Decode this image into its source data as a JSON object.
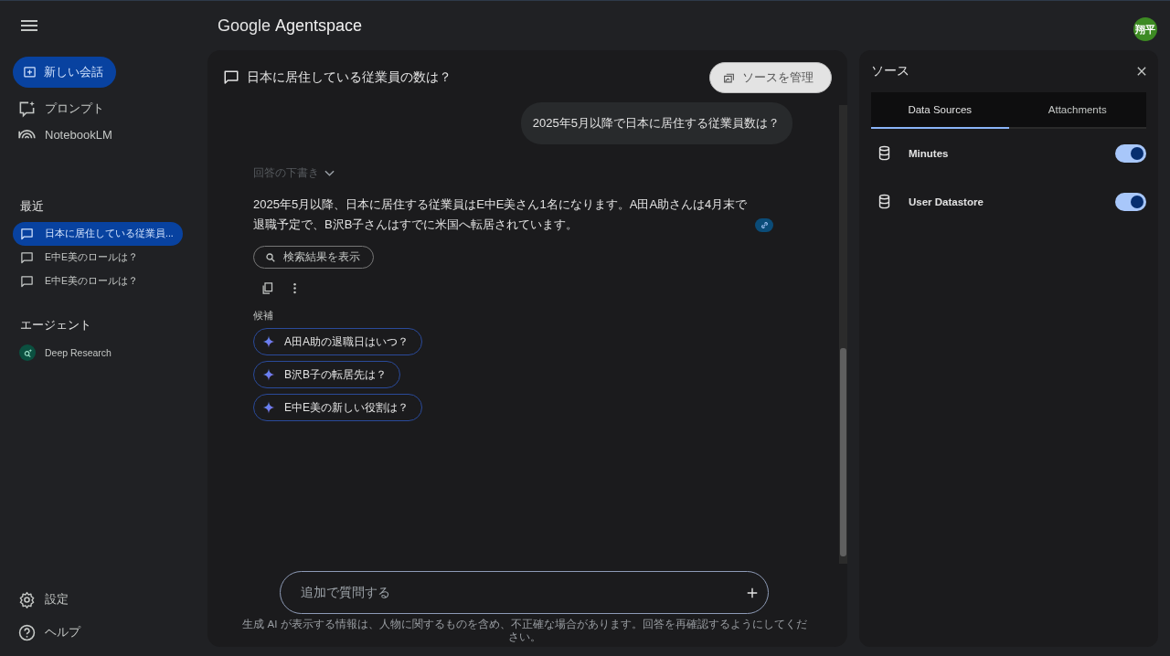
{
  "header": {
    "logo": "Google **Agentspace**",
    "avatar": "翔平"
  },
  "sidebar": {
    "new_chat": "新しい会話",
    "nav": [
      {
        "kind": "prompt",
        "label": "プロンプト"
      },
      {
        "kind": "notebook",
        "label": "NotebookLM"
      }
    ],
    "recent_heading": "最近",
    "recent": [
      {
        "label": "日本に居住している従業員...",
        "selected": true
      },
      {
        "label": "E中E美のロールは？",
        "selected": false
      },
      {
        "label": "E中E美のロールは？",
        "selected": false
      }
    ],
    "agents_heading": "エージェント",
    "agents": [
      {
        "label": "Deep Research"
      }
    ],
    "footer": [
      {
        "kind": "settings",
        "label": "設定"
      },
      {
        "kind": "help",
        "label": "ヘルプ"
      }
    ]
  },
  "chat": {
    "title": "日本に居住している従業員の数は？",
    "manage_sources": "ソースを管理",
    "user_message": "2025年5月以降で日本に居住する従業員数は？",
    "draft_toggle": {
      "label": "回答の下書き",
      "expanded": false
    },
    "answer": "2025年5月以降、日本に居住する従業員はE中E美さん1名になります。A田A助さんは4月末で退職予定で、B沢B子さんはすでに米国へ転居されています。",
    "search_results_button": "検索結果を表示",
    "suggestions_heading": "候補",
    "suggestions": [
      "A田A助の退職日はいつ？",
      "B沢B子の転居先は？",
      "E中E美の新しい役割は？"
    ],
    "input": {
      "placeholder": "追加で質問する"
    },
    "disclaimer": "生成 AI が表示する情報は、人物に関するものを含め、不正確な場合があります。回答を再確認するようにしてください。"
  },
  "sources": {
    "title": "ソース",
    "tabs": [
      {
        "label": "Data Sources",
        "selected": true
      },
      {
        "label": "Attachments",
        "selected": false
      }
    ],
    "items": [
      {
        "name": "Minutes",
        "on": true
      },
      {
        "name": "User Datastore",
        "on": true
      }
    ]
  }
}
